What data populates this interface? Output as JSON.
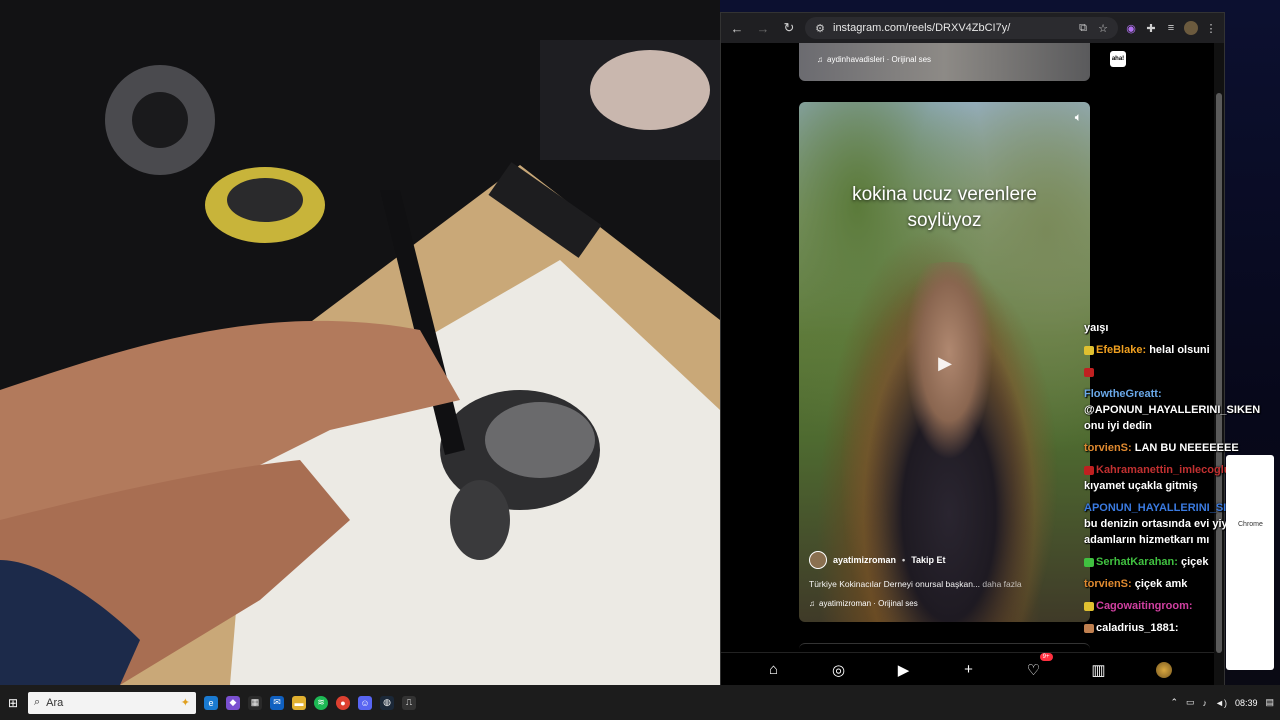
{
  "browser": {
    "url": "instagram.com/reels/DRXV4ZbCI7y/"
  },
  "prev_reel": {
    "sound": "aydinhavadisleri · Orijinal ses",
    "share_label": "aha!"
  },
  "reel": {
    "caption_line1": "kokina ucuz verenlere",
    "caption_line2": "soylüyoz",
    "username": "ayatimizroman",
    "separator": "•",
    "follow_label": "Takip Et",
    "description": "Türkiye Kokinacılar Derneyi onursal başkan...",
    "more_label": "daha fazla",
    "sound": "ayatimizroman · Orijinal ses"
  },
  "bottom_nav": {
    "notif_badge": "9+"
  },
  "chat": [
    {
      "user": "",
      "message": "yaışı",
      "color": "#ffffff"
    },
    {
      "user": "EfeBlake:",
      "message": " helal olsuni",
      "color": "#f0a020"
    },
    {
      "user": "",
      "message": "",
      "color": "#ffffff"
    },
    {
      "user": "FlowtheGreatt:",
      "message": " @APONUN_HAYALLERINI_SIKEN onu iyi dedin",
      "color": "#6aa8e8"
    },
    {
      "user": "torvienS:",
      "message": " LAN BU NEEEEEEE",
      "color": "#e08a30"
    },
    {
      "user": "Kahramanettin_imlecoglu:",
      "message": " @efes kıyamet uçakla gitmiş",
      "color": "#c03030"
    },
    {
      "user": "APONUN_HAYALLERINI_SIKEN:",
      "message": " lan bu denizin ortasında evi yiyen adamların hizmetkarı mı",
      "color": "#3a7ae0"
    },
    {
      "user": "SerhatKarahan:",
      "message": " çiçek",
      "color": "#40c040"
    },
    {
      "user": "torvienS:",
      "message": " çiçek amk",
      "color": "#e08a30"
    },
    {
      "user": "Cagowaitingroom:",
      "message": "",
      "color": "#d040a0"
    },
    {
      "user": "caladrius_1881:",
      "message": "",
      "color": "#ffffff"
    }
  ],
  "side_card": {
    "text": "Chrome"
  },
  "taskbar": {
    "search_placeholder": "Ara",
    "time": "08:39"
  }
}
